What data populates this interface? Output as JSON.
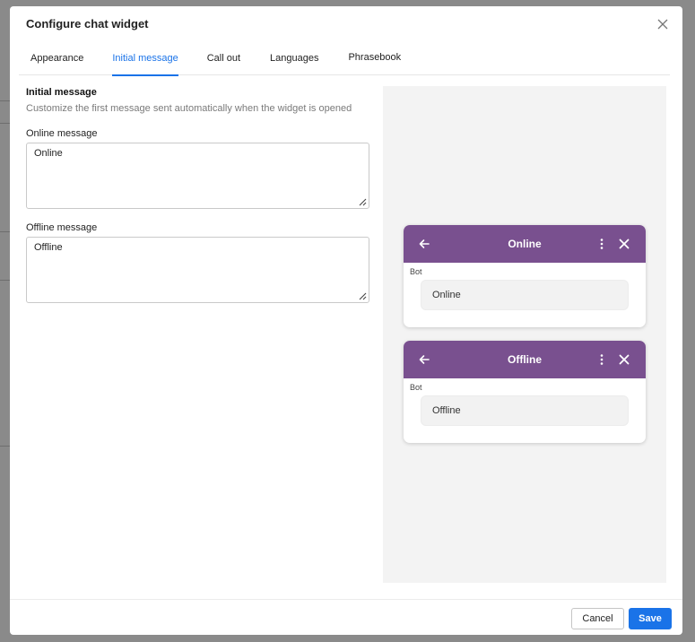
{
  "dialog": {
    "title": "Configure chat widget"
  },
  "tabs": [
    {
      "label": "Appearance",
      "active": false
    },
    {
      "label": "Initial message",
      "active": true
    },
    {
      "label": "Call out",
      "active": false
    },
    {
      "label": "Languages",
      "active": false
    },
    {
      "label": "Phrasebook",
      "active": false
    }
  ],
  "section": {
    "title": "Initial message",
    "description": "Customize the first message sent automatically when the widget is opened"
  },
  "online": {
    "label": "Online message",
    "value": "Online"
  },
  "offline": {
    "label": "Offline message",
    "value": "Offline"
  },
  "preview": {
    "online": {
      "title": "Online",
      "sender": "Bot",
      "message": "Online"
    },
    "offline": {
      "title": "Offline",
      "sender": "Bot",
      "message": "Offline"
    }
  },
  "footer": {
    "cancel_label": "Cancel",
    "save_label": "Save"
  },
  "colors": {
    "accent": "#1a73e8",
    "widget_header": "#79508f",
    "preview_bg": "#f3f3f3"
  }
}
